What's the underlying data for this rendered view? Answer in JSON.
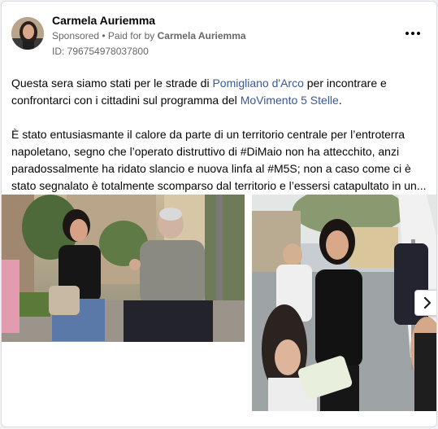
{
  "post": {
    "author": "Carmela Auriemma",
    "sponsored_label": "Sponsored",
    "separator": " • ",
    "paid_for_prefix": "Paid for by ",
    "paid_for_name": "Carmela Auriemma",
    "ad_id": "ID: 796754978037800",
    "menu_icon": "more-options-icon"
  },
  "body": {
    "p1_a": "Questa sera siamo stati per le strade di ",
    "p1_link1": "Pomigliano d'Arco",
    "p1_b": " per incontrare e confrontarci con i cittadini sul programma del ",
    "p1_link2": "MoVimento 5 Stelle",
    "p1_c": ".",
    "p2": "È stato entusiasmante il calore da parte di un territorio centrale per l’entroterra napoletano, segno che l’operato distruttivo di #DiMaio non ha attecchito, anzi paradossalmente ha ridato slancio e nuova linfa al #M5S; non a caso come ci è stato segnalato è totalmente scomparso dal territorio e l’essersi catapultato in un..."
  },
  "media": {
    "next_icon": "chevron-right-icon",
    "colors": {
      "link": "#385898",
      "card_border": "#dadde1",
      "muted": "#65676b"
    }
  }
}
